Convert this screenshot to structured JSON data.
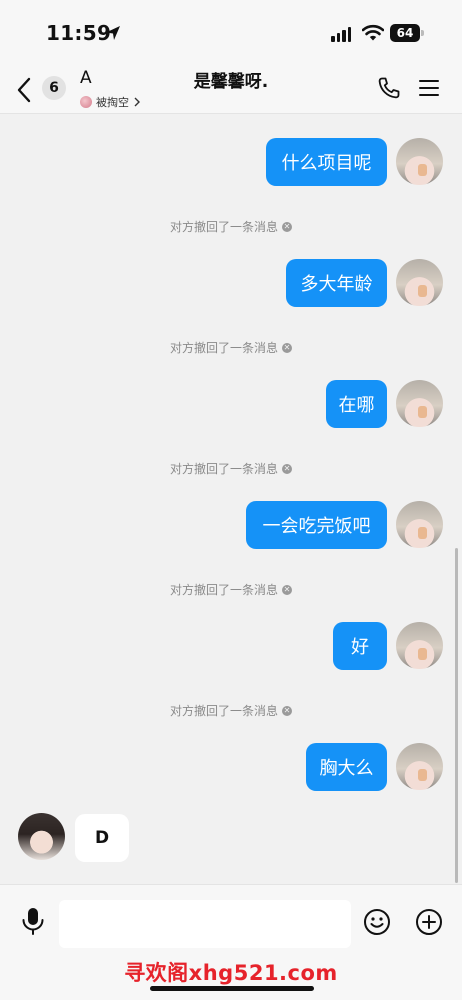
{
  "status_bar": {
    "time": "11:59",
    "battery": "64"
  },
  "header": {
    "unread_count": "6",
    "contact_name": "A",
    "contact_subtitle": "被掏空",
    "title": "是馨馨呀."
  },
  "messages": [
    {
      "type": "outgoing",
      "text": "什么项目呢"
    },
    {
      "type": "system",
      "text": "对方撤回了一条消息"
    },
    {
      "type": "outgoing",
      "text": "多大年龄"
    },
    {
      "type": "system",
      "text": "对方撤回了一条消息"
    },
    {
      "type": "outgoing",
      "text": "在哪"
    },
    {
      "type": "system",
      "text": "对方撤回了一条消息"
    },
    {
      "type": "outgoing",
      "text": "一会吃完饭吧"
    },
    {
      "type": "system",
      "text": "对方撤回了一条消息"
    },
    {
      "type": "outgoing",
      "text": "好"
    },
    {
      "type": "system",
      "text": "对方撤回了一条消息"
    },
    {
      "type": "outgoing",
      "text": "胸大么"
    },
    {
      "type": "incoming",
      "text": "D"
    }
  ],
  "input_bar": {
    "placeholder": ""
  },
  "watermark": "寻欢阁xhg521.com",
  "colors": {
    "outgoing_bubble": "#1592f7",
    "incoming_bubble": "#ffffff",
    "background": "#f1f1f1",
    "watermark": "#e6232b"
  },
  "icons": [
    "location-arrow-icon",
    "signal-icon",
    "wifi-icon",
    "battery-icon",
    "back-chevron-icon",
    "phone-icon",
    "menu-icon",
    "microphone-icon",
    "emoji-icon",
    "add-icon"
  ]
}
